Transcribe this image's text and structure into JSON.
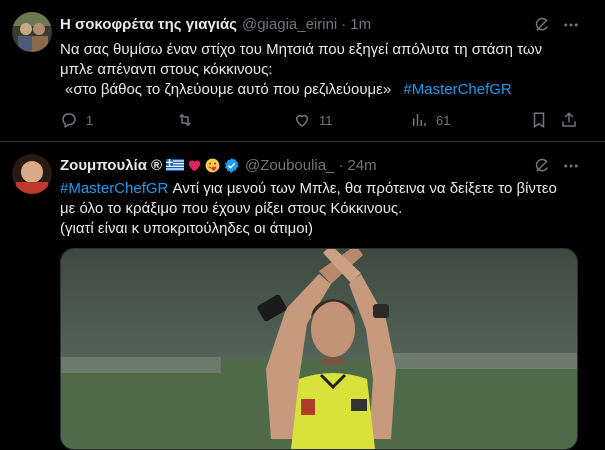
{
  "tweets": [
    {
      "name": "Η σοκοφρέτα της γιαγιάς",
      "handle": "@giagia_eirini",
      "separator": "·",
      "time": "1m",
      "lines": [
        "Να σας θυμίσω έναν στίχο του Μητσιά που εξηγεί απόλυτα τη στάση των",
        "μπλε απέναντι στους κόκκινους:",
        "«στο βάθος το ζηλεύουμε αυτό που ρεζιλεύουμε»"
      ],
      "hashtag": "#MasterChefGR",
      "replies": "1",
      "retweets": "",
      "likes": "11",
      "views": "61"
    },
    {
      "name": "Ζουμπουλία",
      "name_suffix": "®",
      "handle": "@Zouboulia_",
      "separator": "·",
      "time": "24m",
      "hashtag": "#MasterChefGR",
      "lines": [
        "Αντί για μενού των Μπλε, θα πρότεινα να δείξετε το βίντεο",
        "με όλο το κράξιμο που έχουν ρίξει στους Κόκκινους.",
        "(γιατί είναι κ υποκριτούληδες οι άτιμοι)"
      ]
    }
  ],
  "colors": {
    "background": "#000000",
    "text": "#e7e9ea",
    "muted": "#71767b",
    "accent": "#1d9bf0",
    "divider": "#2f3336"
  },
  "icons": [
    "grok-icon",
    "more-icon",
    "reply-icon",
    "retweet-icon",
    "like-icon",
    "views-icon",
    "bookmark-icon",
    "share-icon",
    "verified-icon"
  ]
}
